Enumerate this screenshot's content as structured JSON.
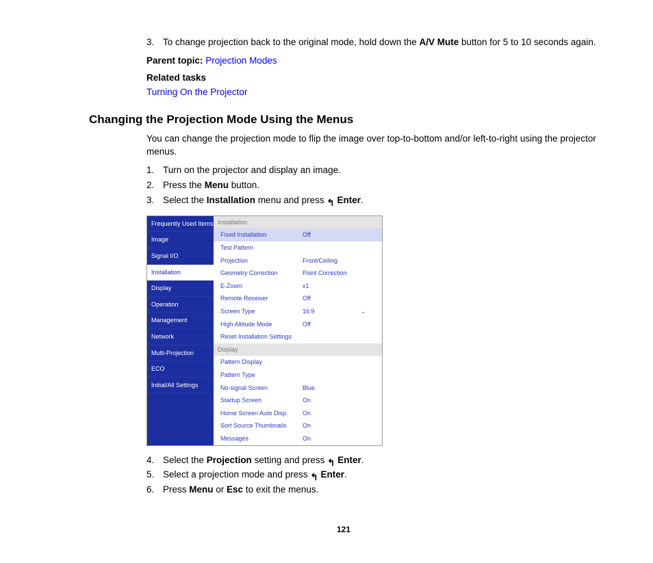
{
  "top": {
    "step3_num": "3.",
    "step3_a": "To change projection back to the original mode, hold down the ",
    "step3_bold": "A/V Mute",
    "step3_b": " button for 5 to 10 seconds again.",
    "parent_label": "Parent topic:",
    "parent_link": "Projection Modes",
    "related_label": "Related tasks",
    "related_link": "Turning On the Projector"
  },
  "heading": "Changing the Projection Mode Using the Menus",
  "intro": "You can change the projection mode to flip the image over top-to-bottom and/or left-to-right using the projector menus.",
  "steps_a": {
    "n1": "1.",
    "t1": "Turn on the projector and display an image.",
    "n2": "2.",
    "t2a": "Press the ",
    "t2b": "Menu",
    "t2c": " button.",
    "n3": "3.",
    "t3a": "Select the ",
    "t3b": "Installation",
    "t3c": " menu and press ",
    "t3d": "Enter",
    "t3e": "."
  },
  "menu": {
    "left": [
      "Frequently Used Items",
      "Image",
      "Signal I/O",
      "Installation",
      "Display",
      "Operation",
      "Management",
      "Network",
      "Multi-Projection",
      "ECO",
      "Initial/All Settings"
    ],
    "left_selected_index": 3,
    "section1": "Installation",
    "rows1": [
      {
        "label": "Fixed Installation",
        "value": "Off",
        "selected": true
      },
      {
        "label": "Test Pattern",
        "value": ""
      },
      {
        "label": "Projection",
        "value": "Front/Ceiling"
      },
      {
        "label": "Geometry Correction",
        "value": "Point Correction"
      },
      {
        "label": "E-Zoom",
        "value": "x1"
      },
      {
        "label": "Remote Receiver",
        "value": "Off"
      },
      {
        "label": "Screen Type",
        "value": "16:9",
        "chev": true
      },
      {
        "label": "High Altitude Mode",
        "value": "Off"
      },
      {
        "label": "Reset Installation Settings",
        "value": ""
      }
    ],
    "section2": "Display",
    "rows2": [
      {
        "label": "Pattern Display",
        "value": ""
      },
      {
        "label": "Pattern Type",
        "value": ""
      },
      {
        "label": "No-signal Screen",
        "value": "Blue"
      },
      {
        "label": "Startup Screen",
        "value": "On"
      },
      {
        "label": "Home Screen Auto Disp.",
        "value": "On"
      },
      {
        "label": "Sort Source Thumbnails",
        "value": "On"
      },
      {
        "label": "Messages",
        "value": "On"
      }
    ]
  },
  "steps_b": {
    "n4": "4.",
    "t4a": "Select the ",
    "t4b": "Projection",
    "t4c": " setting and press ",
    "t4d": "Enter",
    "t4e": ".",
    "n5": "5.",
    "t5a": "Select a projection mode and press ",
    "t5b": "Enter",
    "t5c": ".",
    "n6": "6.",
    "t6a": "Press ",
    "t6b": "Menu",
    "t6c": " or ",
    "t6d": "Esc",
    "t6e": " to exit the menus."
  },
  "page_number": "121"
}
